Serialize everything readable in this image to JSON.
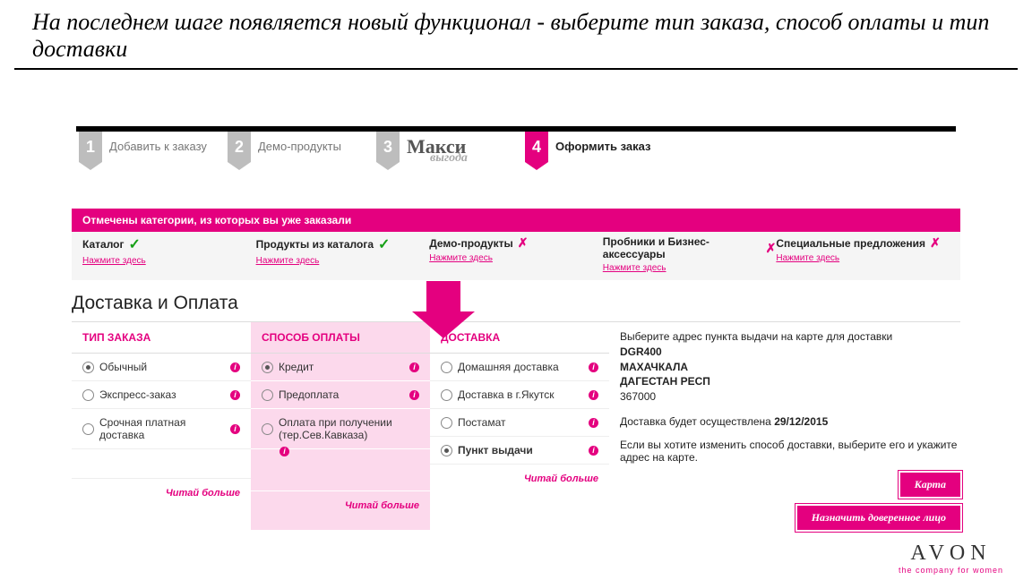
{
  "heading": "На последнем шаге появляется новый функционал -  выберите тип заказа, способ оплаты и тип доставки",
  "steps": [
    {
      "num": "1",
      "label": "Добавить к заказу"
    },
    {
      "num": "2",
      "label": "Демо-продукты"
    },
    {
      "num": "3",
      "label": "Макси",
      "sub": "выгода"
    },
    {
      "num": "4",
      "label": "Оформить заказ"
    }
  ],
  "banner": "Отмечены категории, из которых вы уже заказали",
  "categories": [
    {
      "name": "Каталог",
      "status": "check",
      "link": "Нажмите здесь"
    },
    {
      "name": "Продукты из каталога",
      "status": "check",
      "link": "Нажмите здесь"
    },
    {
      "name": "Демо-продукты",
      "status": "cross",
      "link": "Нажмите здесь"
    },
    {
      "name": "Пробники и Бизнес-аксессуары",
      "status": "cross",
      "link": "Нажмите здесь"
    },
    {
      "name": "Специальные предложения",
      "status": "cross",
      "link": "Нажмите здесь"
    }
  ],
  "section_title": "Доставка и Оплата",
  "order_type": {
    "title": "ТИП ЗАКАЗА",
    "options": [
      {
        "label": "Обычный",
        "selected": true
      },
      {
        "label": "Экспресс-заказ",
        "selected": false
      },
      {
        "label": "Срочная платная доставка",
        "selected": false
      }
    ],
    "readmore": "Читай больше"
  },
  "payment": {
    "title": "СПОСОБ ОПЛАТЫ",
    "options": [
      {
        "label": "Кредит",
        "selected": true
      },
      {
        "label": "Предоплата",
        "selected": false
      },
      {
        "label": "Оплата при получении (тер.Сев.Кавказа)",
        "selected": false
      }
    ],
    "readmore": "Читай больше"
  },
  "delivery": {
    "title": "ДОСТАВКА",
    "options": [
      {
        "label": "Домашняя доставка",
        "selected": false
      },
      {
        "label": "Доставка в г.Якутск",
        "selected": false
      },
      {
        "label": "Постамат",
        "selected": false
      },
      {
        "label": "Пункт выдачи",
        "selected": true
      }
    ],
    "readmore": "Читай больше"
  },
  "address": {
    "intro": "Выберите адрес пункта выдачи на карте для доставки",
    "code": "DGR400",
    "city": "МАХАЧКАЛА",
    "region": "ДАГЕСТАН РЕСП",
    "zip": "367000",
    "date_prefix": "Доставка будет осуществлена ",
    "date": "29/12/2015",
    "change": "Если вы хотите изменить способ доставки, выберите его и укажите адрес на карте.",
    "btn_map": "Карта",
    "btn_proxy": "Назначить доверенное лицо"
  },
  "brand": {
    "logo": "AVON",
    "tag": "the company for women"
  }
}
